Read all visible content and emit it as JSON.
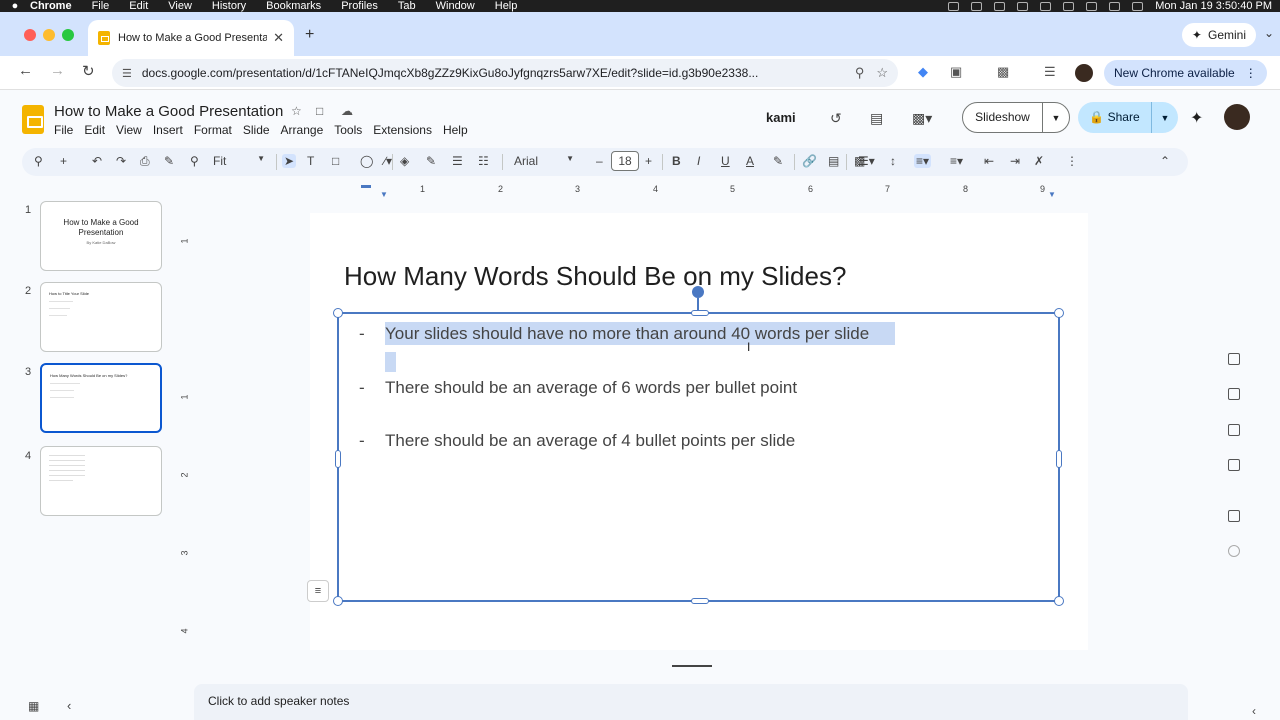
{
  "menubar": {
    "apple": "",
    "app": "Chrome",
    "items": [
      "File",
      "Edit",
      "View",
      "History",
      "Bookmarks",
      "Profiles",
      "Tab",
      "Window",
      "Help"
    ],
    "clock": "Mon Jan 19  3:50:40 PM"
  },
  "browser": {
    "tab_title": "How to Make a Good Presentati",
    "new_tab": "+",
    "gemini": "Gemini",
    "url": "docs.google.com/presentation/d/1cFTANeIQJmqcXb8gZZz9KixGu8oJyfgnqzrs5arw7XE/edit?slide=id.g3b90e2338...",
    "new_chrome": "New Chrome available"
  },
  "docs": {
    "title": "How to Make a Good Presentation",
    "menus": [
      "File",
      "Edit",
      "View",
      "Insert",
      "Format",
      "Slide",
      "Arrange",
      "Tools",
      "Extensions",
      "Help"
    ],
    "kami": "kami",
    "slideshow": "Slideshow",
    "share": "Share"
  },
  "toolbar": {
    "zoom": "Fit",
    "font": "Arial",
    "font_size": "18"
  },
  "ruler": {
    "top": [
      "1",
      "2",
      "3",
      "4",
      "5",
      "6",
      "7",
      "8",
      "9"
    ],
    "left": [
      "1",
      "1",
      "2",
      "3",
      "4"
    ]
  },
  "filmstrip": [
    {
      "num": "1",
      "title": "How to Make a Good Presentation",
      "sub": "By Katie DaBow"
    },
    {
      "num": "2",
      "title": "How to Title Your Slide"
    },
    {
      "num": "3",
      "title": "How Many Words Should Be on my Slides?"
    },
    {
      "num": "4"
    }
  ],
  "slide": {
    "title": "How Many Words Should Be on my Slides?",
    "bullets": [
      "Your slides should have no more than around 40 words per slide",
      "There should be an average of 6 words per bullet point",
      "There should be an average of 4 bullet points per slide"
    ],
    "dash": "-"
  },
  "notes": {
    "placeholder": "Click to add speaker notes"
  },
  "colors": {
    "selection": "#c8d9f4",
    "accent": "#4a78c2",
    "share": "#c2e7ff"
  }
}
